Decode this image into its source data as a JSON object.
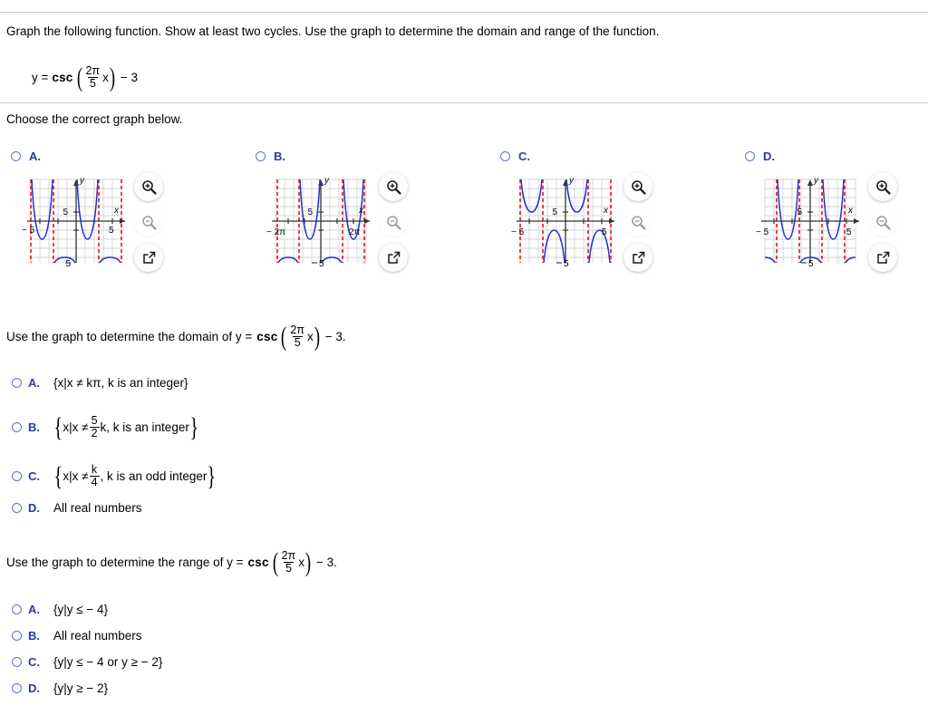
{
  "question": {
    "instruction": "Graph the following function. Show at least two cycles. Use the graph to determine the domain and range of the function.",
    "formula": {
      "lhs": "y =",
      "func": "csc",
      "frac_num": "2π",
      "frac_den": "5",
      "var": "x",
      "tail": "− 3"
    },
    "choose_prompt": "Choose the correct graph below."
  },
  "graph_choices": [
    {
      "letter": "A.",
      "x_left_label": "− 5",
      "x_right_label": "5",
      "y_top_label": "5",
      "y_bottom_label": "5",
      "x_axis_label": "x",
      "y_axis_label": "y",
      "tools": [
        "zoom-in-icon",
        "zoom-out-icon",
        "popout-icon"
      ]
    },
    {
      "letter": "B.",
      "x_left_label": "− 2π",
      "x_right_label": "2π",
      "y_top_label": "5",
      "y_bottom_label": "5",
      "x_axis_label": "x",
      "y_axis_label": "y",
      "tools": [
        "zoom-in-icon",
        "zoom-out-icon",
        "popout-icon"
      ]
    },
    {
      "letter": "C.",
      "x_left_label": "− 5",
      "x_right_label": "5",
      "y_top_label": "5",
      "y_bottom_label": "5",
      "x_axis_label": "x",
      "y_axis_label": "y",
      "tools": [
        "zoom-in-icon",
        "zoom-out-icon",
        "popout-icon"
      ]
    },
    {
      "letter": "D.",
      "x_left_label": "− 5",
      "x_right_label": "5",
      "y_top_label": "5",
      "y_bottom_label": "5",
      "x_axis_label": "x",
      "y_axis_label": "y",
      "tools": [
        "zoom-in-icon",
        "zoom-out-icon",
        "popout-icon"
      ]
    }
  ],
  "domain_question": {
    "prefix": "Use the graph to determine the domain of y =",
    "func": "csc",
    "frac_num": "2π",
    "frac_den": "5",
    "var": "x",
    "tail": "− 3.",
    "options": [
      {
        "letter": "A.",
        "text": "{x|x ≠ kπ, k is an integer}",
        "kind": "plain"
      },
      {
        "letter": "B.",
        "pre": "x|x ≠",
        "num": "5",
        "den": "2",
        "post": "k, k is an integer",
        "kind": "fraction"
      },
      {
        "letter": "C.",
        "pre": "x|x ≠",
        "num": "k",
        "den": "4",
        "post": ", k is an odd integer",
        "kind": "fraction"
      },
      {
        "letter": "D.",
        "text": "All real numbers",
        "kind": "plain"
      }
    ]
  },
  "range_question": {
    "prefix": "Use the graph to determine the range of y =",
    "func": "csc",
    "frac_num": "2π",
    "frac_den": "5",
    "var": "x",
    "tail": "− 3.",
    "options": [
      {
        "letter": "A.",
        "text": "{y|y ≤ − 4}"
      },
      {
        "letter": "B.",
        "text": "All real numbers"
      },
      {
        "letter": "C.",
        "text": "{y|y ≤ − 4 or y ≥ − 2}"
      },
      {
        "letter": "D.",
        "text": "{y|y ≥ − 2}"
      }
    ]
  },
  "chart_data": [
    {
      "id": "A",
      "type": "line",
      "title": "",
      "xlabel": "x",
      "ylabel": "y",
      "xlim": [
        -6,
        6
      ],
      "ylim": [
        -6,
        6
      ],
      "xticks": [
        -5,
        5
      ],
      "yticks": [
        5,
        -5
      ],
      "grid": true,
      "curve_color": "#2433d0",
      "asymptote_color": "#ee1c25",
      "asymptotes": [
        -5,
        -2.5,
        0,
        2.5,
        5
      ],
      "function": "csc(2*pi*x/5) - 3 reflected-upper",
      "branch_minimum": -2,
      "branch_maximum": -4,
      "period": 5,
      "description": "Upward branches with minimum y=-2 on intervals (-5,-2.5) and (0,2.5); downward branches with maximum y=-4 on (-2.5,0) and (2.5,5)"
    },
    {
      "id": "B",
      "type": "line",
      "title": "",
      "xlabel": "x",
      "ylabel": "y",
      "xlim": [
        -7.5,
        7.5
      ],
      "ylim": [
        -6,
        6
      ],
      "xticks": [
        -6.283,
        6.283
      ],
      "yticks": [
        5,
        -5
      ],
      "grid": true,
      "curve_color": "#2433d0",
      "asymptote_color": "#ee1c25",
      "asymptotes": [
        -6.283,
        -3.14,
        0,
        3.14,
        6.283
      ],
      "function": "csc(x) - 3",
      "branch_minimum": -2,
      "branch_maximum": -4,
      "period": 6.283,
      "description": "Upward branches minimum y=-2 on (-3.14,0) and (3.14,6.283); downward branches maximum y=-4 on (-6.283,-3.14) and (0,3.14)"
    },
    {
      "id": "C",
      "type": "line",
      "title": "",
      "xlabel": "x",
      "ylabel": "y",
      "xlim": [
        -6,
        6
      ],
      "ylim": [
        -6,
        6
      ],
      "xticks": [
        -5,
        5
      ],
      "yticks": [
        5,
        -5
      ],
      "grid": true,
      "curve_color": "#2433d0",
      "asymptote_color": "#ee1c25",
      "asymptotes": [
        -5,
        -2.5,
        0,
        2.5,
        5
      ],
      "function": "csc(2*pi*x/5)",
      "branch_minimum": 1,
      "branch_maximum": -1,
      "period": 5,
      "description": "Upward branches minimum y=1 above axis on (-5,-2.5) and (0,2.5); downward branches maximum y=-1 below axis on (-2.5,0) and (2.5,5)"
    },
    {
      "id": "D",
      "type": "line",
      "title": "",
      "xlabel": "x",
      "ylabel": "y",
      "xlim": [
        -6,
        6
      ],
      "ylim": [
        -6,
        6
      ],
      "xticks": [
        -5,
        5
      ],
      "yticks": [
        5,
        -5
      ],
      "grid": true,
      "curve_color": "#2433d0",
      "asymptote_color": "#ee1c25",
      "asymptotes": [
        -3.75,
        -1.25,
        1.25,
        3.75
      ],
      "function": "csc(2*pi*x/5 + phase) - 3",
      "branch_minimum": -2,
      "branch_maximum": -4,
      "period": 5,
      "description": "Shifted version: upward branches minimum y=-2 on (-3.75,-1.25) and (1.25,3.75); downward branches maximum y=-4 on (-1.25,1.25) edges"
    }
  ]
}
